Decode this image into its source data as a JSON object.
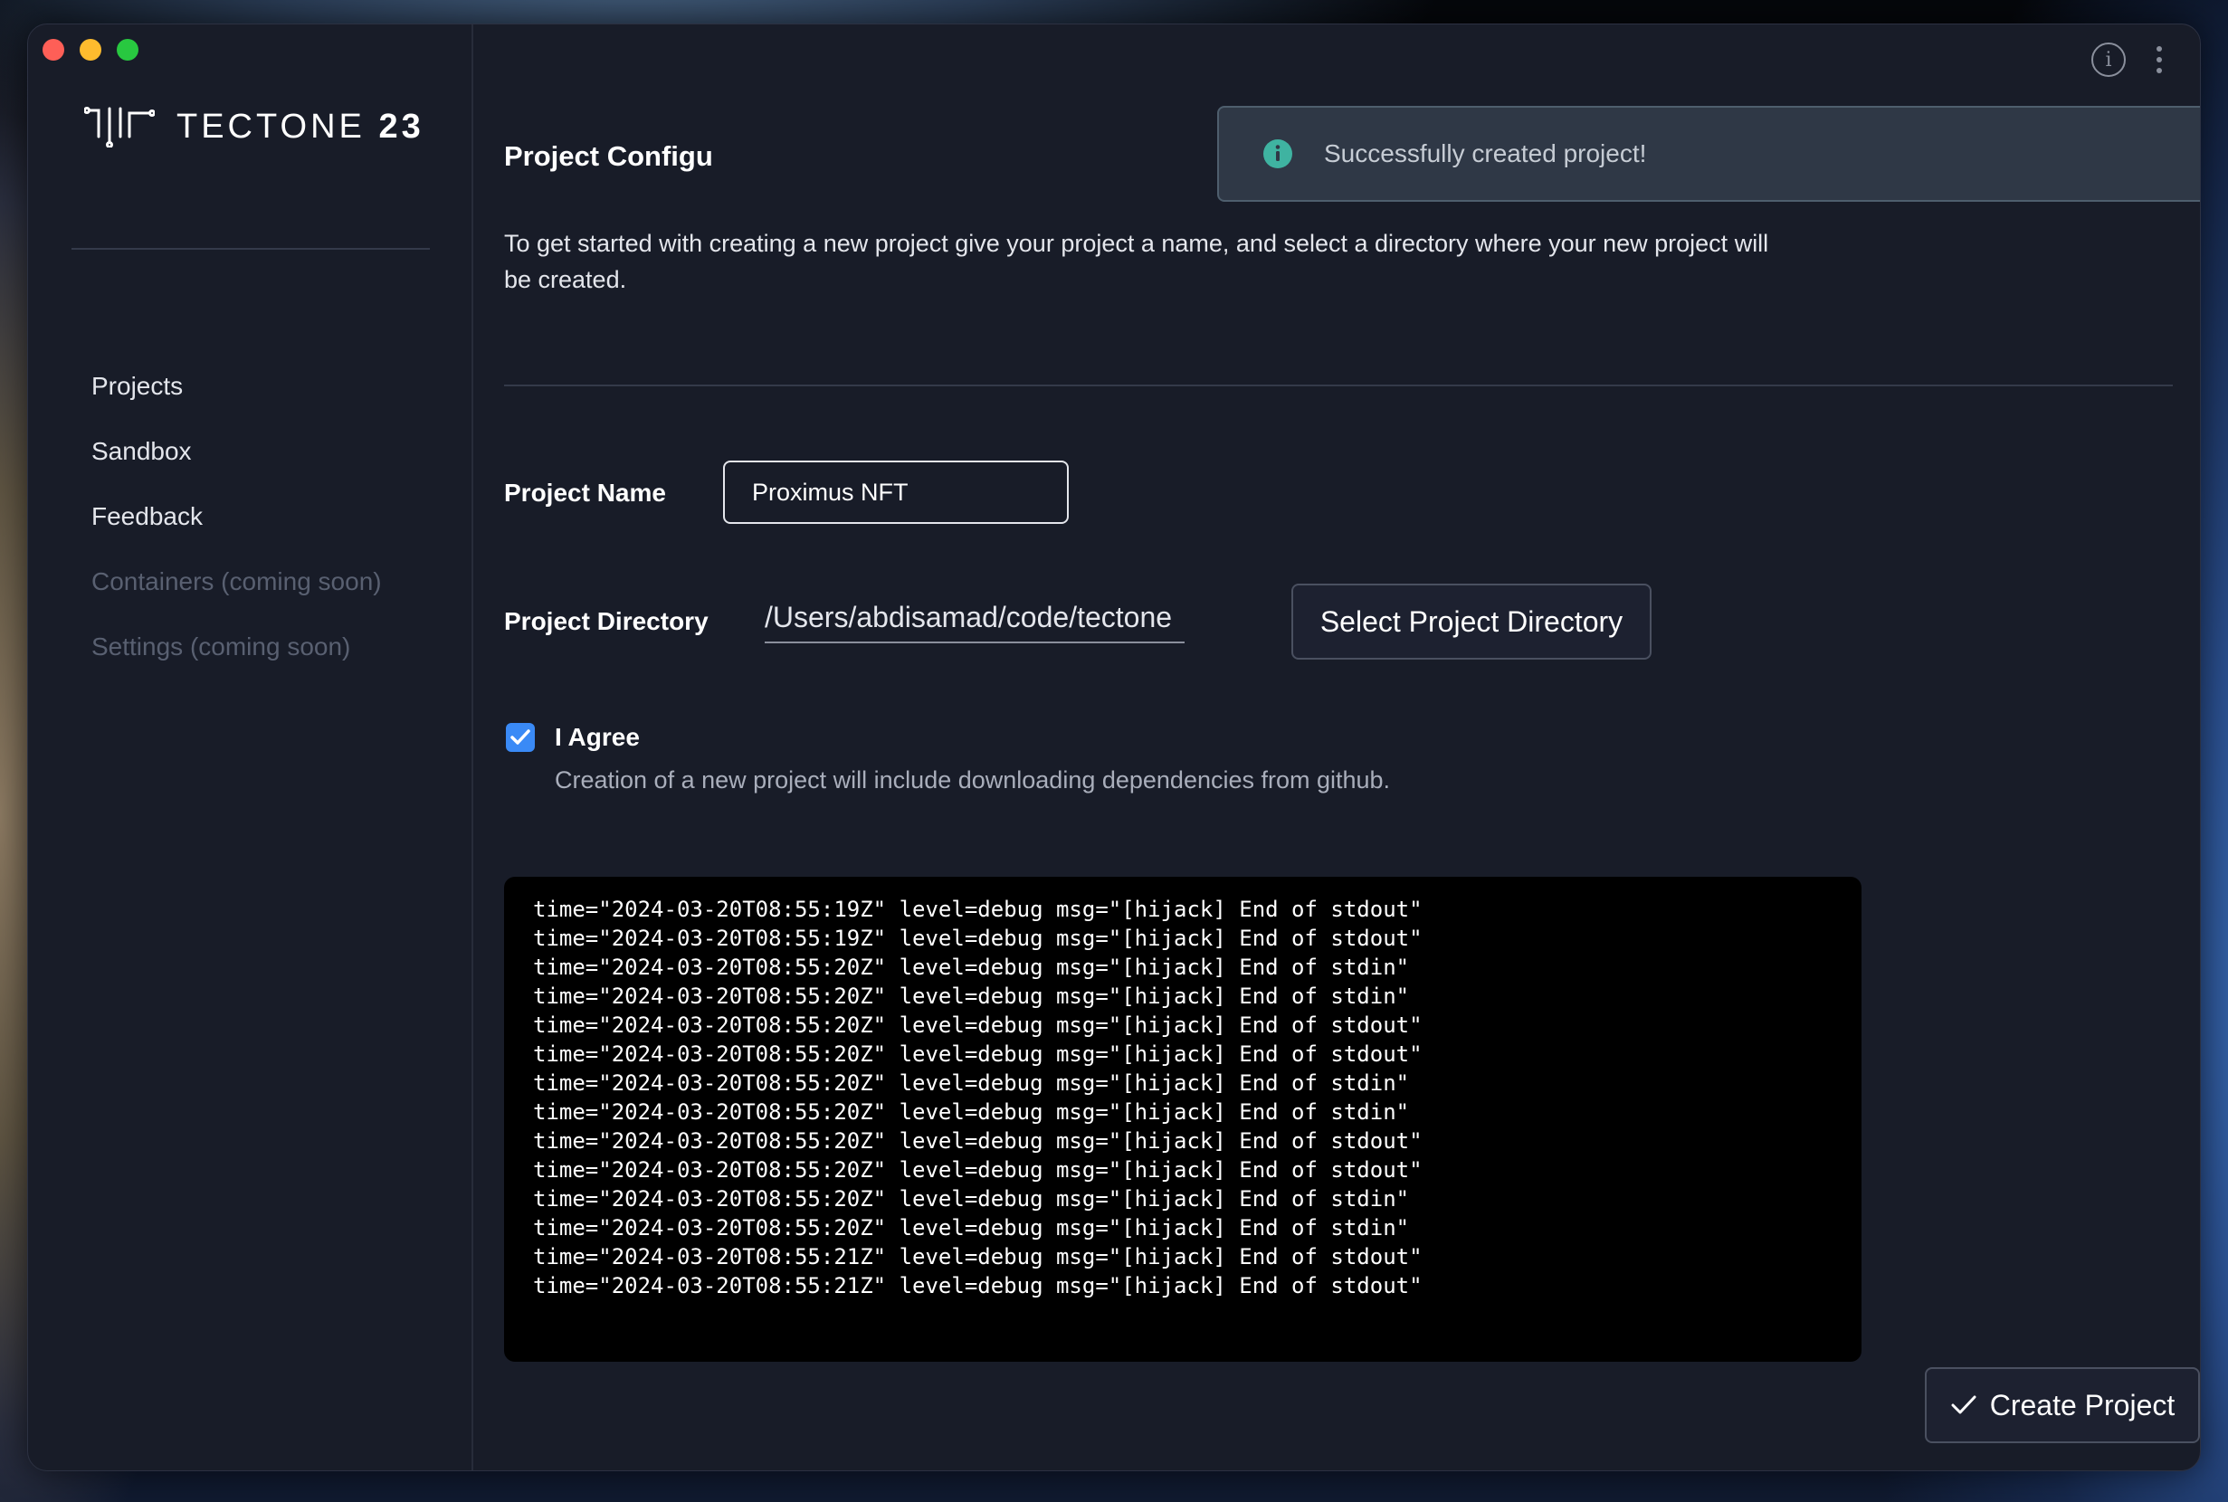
{
  "app": {
    "logo_text": "TECTONE",
    "logo_version": "23"
  },
  "sidebar": {
    "items": [
      {
        "label": "Projects"
      },
      {
        "label": "Sandbox"
      },
      {
        "label": "Feedback"
      },
      {
        "label": "Containers (coming soon)"
      },
      {
        "label": "Settings (coming soon)"
      }
    ]
  },
  "toast": {
    "message": "Successfully created project!",
    "icon": "info-icon",
    "accent_color": "#3fb3a1"
  },
  "main": {
    "title": "Project Configu",
    "intro": "To get started with creating a new project give your project a name, and select a directory where your new project will be created.",
    "project_name_label": "Project Name",
    "project_name_value": "Proximus NFT",
    "project_directory_label": "Project Directory",
    "project_directory_value": "/Users/abdisamad/code/tectone",
    "select_directory_button": "Select Project Directory",
    "agree_label": "I Agree",
    "agree_checked": true,
    "agree_description": "Creation of a new project will include downloading dependencies from github.",
    "create_button": "Create Project"
  },
  "terminal": {
    "lines": [
      "time=\"2024-03-20T08:55:19Z\" level=debug msg=\"[hijack] End of stdout\"",
      "time=\"2024-03-20T08:55:19Z\" level=debug msg=\"[hijack] End of stdout\"",
      "time=\"2024-03-20T08:55:20Z\" level=debug msg=\"[hijack] End of stdin\"",
      "time=\"2024-03-20T08:55:20Z\" level=debug msg=\"[hijack] End of stdin\"",
      "time=\"2024-03-20T08:55:20Z\" level=debug msg=\"[hijack] End of stdout\"",
      "time=\"2024-03-20T08:55:20Z\" level=debug msg=\"[hijack] End of stdout\"",
      "time=\"2024-03-20T08:55:20Z\" level=debug msg=\"[hijack] End of stdin\"",
      "time=\"2024-03-20T08:55:20Z\" level=debug msg=\"[hijack] End of stdin\"",
      "time=\"2024-03-20T08:55:20Z\" level=debug msg=\"[hijack] End of stdout\"",
      "time=\"2024-03-20T08:55:20Z\" level=debug msg=\"[hijack] End of stdout\"",
      "time=\"2024-03-20T08:55:20Z\" level=debug msg=\"[hijack] End of stdin\"",
      "time=\"2024-03-20T08:55:20Z\" level=debug msg=\"[hijack] End of stdin\"",
      "time=\"2024-03-20T08:55:21Z\" level=debug msg=\"[hijack] End of stdout\"",
      "time=\"2024-03-20T08:55:21Z\" level=debug msg=\"[hijack] End of stdout\""
    ]
  },
  "icons": {
    "window_close": "close-window-icon",
    "window_minimize": "minimize-window-icon",
    "window_zoom": "zoom-window-icon",
    "about": "info-circle-icon",
    "menu": "more-vertical-icon",
    "checkbox": "checkmark-icon",
    "create": "checkmark-icon",
    "toast_close": "close-icon"
  }
}
